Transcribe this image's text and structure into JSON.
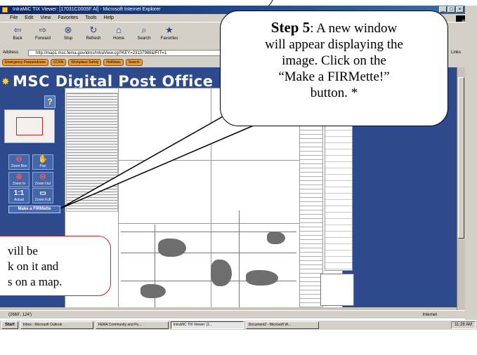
{
  "window": {
    "title": "IntraMiC TIX Viewer: [17031C0005F Al] - Microsoft Internet Explorer",
    "min": "_",
    "max": "□",
    "close": "×"
  },
  "menu": [
    "File",
    "Edit",
    "View",
    "Favorites",
    "Tools",
    "Help"
  ],
  "toolbar": [
    {
      "label": "Back",
      "icon": "back-icon",
      "glyph": "⇦"
    },
    {
      "label": "Forward",
      "icon": "forward-icon",
      "glyph": "⇨"
    },
    {
      "label": "Stop",
      "icon": "stop-icon",
      "glyph": "⊗"
    },
    {
      "label": "Refresh",
      "icon": "refresh-icon",
      "glyph": "↻"
    },
    {
      "label": "Home",
      "icon": "home-icon",
      "glyph": "⌂"
    },
    {
      "label": "Search",
      "icon": "search-icon",
      "glyph": "⌕"
    },
    {
      "label": "Favorites",
      "icon": "favorites-icon",
      "glyph": "★"
    }
  ],
  "address": {
    "label": "Address",
    "value": "http://map1.msc.fema.gov/idms/IntraView.cgi?KEY=23137988&IFIT=1",
    "links_label": "Links"
  },
  "links": [
    "Emergency Preparedness",
    "CCNN",
    "Workplace Safety",
    "HotNews",
    "Search"
  ],
  "app": {
    "title": "MSC Digital Post Office",
    "help_label": "?",
    "tools": [
      {
        "key": "zoom_box",
        "glyph": "⊖",
        "label": "Zoom Box",
        "color": "r"
      },
      {
        "key": "pan",
        "glyph": "✋",
        "label": "Pan",
        "color": "y"
      },
      {
        "key": "zoom_in",
        "glyph": "⊕",
        "label": "Zoom In",
        "color": "r"
      },
      {
        "key": "zoom_out",
        "glyph": "⊖",
        "label": "Zoom Out",
        "color": "r"
      },
      {
        "key": "actual",
        "glyph": "1:1",
        "label": "Actual",
        "color": "w"
      },
      {
        "key": "full",
        "glyph": "▭",
        "label": "Zoom Full",
        "color": "w"
      }
    ],
    "firmette_button": "Make a FIRMette"
  },
  "status": {
    "coords": "(2660', 124')",
    "zone": "Internet"
  },
  "taskbar": {
    "start": "Start",
    "items": [
      "Inbox - Microsoft Outlook",
      "FEMA Community and Po...",
      "IntraMiC TIX Viewer: [1...",
      "Document2 - Microsoft W..."
    ],
    "clock": "11:28 AM"
  },
  "callouts": {
    "step_label": "Step 5",
    "step_lines": [
      ": A new window",
      "will appear displaying the",
      "image. Click on the",
      "“Make a FIRMette!”",
      "button. *"
    ],
    "red_lines": [
      "vill be",
      "k on it and",
      "s on a map."
    ]
  },
  "colors": {
    "content_bg": "#2c4a8c",
    "titlebar": "#0a246a",
    "callout_red": "#cc2222"
  }
}
